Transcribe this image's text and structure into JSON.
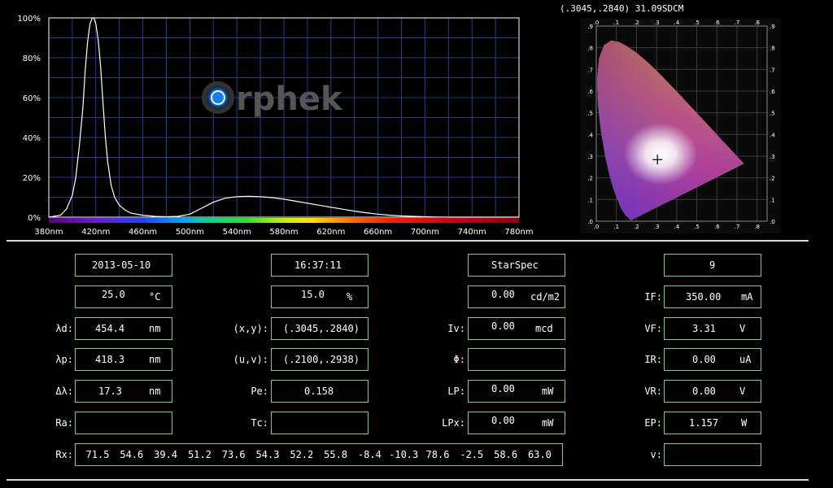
{
  "chart_data": {
    "type": "line",
    "title": "",
    "xlabel": "",
    "ylabel": "",
    "xlim": [
      380,
      780
    ],
    "ylim": [
      0,
      100
    ],
    "x_ticks": [
      "380nm",
      "420nm",
      "460nm",
      "500nm",
      "540nm",
      "580nm",
      "620nm",
      "660nm",
      "700nm",
      "740nm",
      "780nm"
    ],
    "y_ticks": [
      "0%",
      "20%",
      "40%",
      "60%",
      "80%",
      "100%"
    ],
    "grid": true,
    "series": [
      {
        "x": [
          380,
          390,
          395,
          400,
          403,
          406,
          409,
          411,
          413,
          415,
          417,
          418.3,
          420,
          422,
          424,
          426,
          428,
          430,
          433,
          436,
          440,
          445,
          450,
          460,
          470,
          480,
          490,
          500,
          510,
          520,
          530,
          540,
          550,
          560,
          570,
          580,
          590,
          600,
          610,
          620,
          630,
          640,
          650,
          660,
          670,
          680,
          690,
          700,
          710,
          720,
          740,
          760,
          780
        ],
        "y": [
          0,
          1,
          4,
          11,
          20,
          36,
          55,
          74,
          88,
          97,
          100,
          100,
          97,
          89,
          76,
          58,
          41,
          28,
          16,
          10,
          6,
          3.5,
          2,
          1,
          0.4,
          0.2,
          0.4,
          1.5,
          4.5,
          7.5,
          9.5,
          10.3,
          10.5,
          10.3,
          9.8,
          9,
          8,
          7,
          6,
          5,
          4,
          3,
          2.2,
          1.5,
          1,
          0.6,
          0.4,
          0.2,
          0.1,
          0,
          0,
          0,
          0
        ]
      }
    ],
    "logo": "orphek"
  },
  "cie": {
    "header": "(.3045,.2840) 31.09SDCM",
    "point": [
      0.3045,
      0.284
    ],
    "x_ticks": [
      ".0",
      ".1",
      ".2",
      ".3",
      ".4",
      ".5",
      ".6",
      ".7",
      ".8"
    ],
    "y_ticks": [
      ".0",
      ".1",
      ".2",
      ".3",
      ".4",
      ".5",
      ".6",
      ".7",
      ".8",
      ".9"
    ]
  },
  "colors": {
    "border": "#7fd07f",
    "grid": "#2a3e8a",
    "curve": "#ffffff",
    "bg": "#000000"
  },
  "panel": {
    "row1": {
      "date": "2013-05-10",
      "time": "16:37:11",
      "instrument": "StarSpec",
      "number": "9"
    },
    "row2": {
      "temp": "25.0",
      "temp_unit": "°C",
      "humidity": "15.0",
      "humidity_unit": "%",
      "lum_val": "0.00",
      "lum_unit": "cd/m2",
      "if_label": "IF:",
      "if_val": "350.00",
      "if_unit": "mA"
    },
    "row3": {
      "ld_label": "λd:",
      "ld_val": "454.4",
      "ld_unit": "nm",
      "xy_label": "(x,y):",
      "xy_val": "(.3045,.2840)",
      "iv_label": "Iv:",
      "iv_val": "0.00",
      "iv_unit": "mcd",
      "vf_label": "VF:",
      "vf_val": "3.31",
      "vf_unit": "V"
    },
    "row4": {
      "lp_label": "λp:",
      "lp_val": "418.3",
      "lp_unit": "nm",
      "uv_label": "(u,v):",
      "uv_val": "(.2100,.2938)",
      "phi_label": "Φ:",
      "ir_label": "IR:",
      "ir_val": "0.00",
      "ir_unit": "uA"
    },
    "row5": {
      "dl_label": "Δλ:",
      "dl_val": "17.3",
      "dl_unit": "nm",
      "pe_label": "Pe:",
      "pe_val": "0.158",
      "lpw_label": "LP:",
      "lpw_val": "0.00",
      "lpw_unit": "mW",
      "vr_label": "VR:",
      "vr_val": "0.00",
      "vr_unit": "V"
    },
    "row6": {
      "ra_label": "Ra:",
      "tc_label": "Tc:",
      "lpx_label": "LPx:",
      "lpx_val": "0.00",
      "lpx_unit": "mW",
      "ep_label": "EP:",
      "ep_val": "1.157",
      "ep_unit": "W"
    },
    "row7": {
      "rx_label": "Rx:",
      "rx_values": [
        "71.5",
        "54.6",
        "39.4",
        "51.2",
        "73.6",
        "54.3",
        "52.2",
        "55.8",
        "-8.4",
        "-10.3",
        "78.6",
        "-2.5",
        "58.6",
        "63.0"
      ],
      "v_label": "v:"
    }
  }
}
